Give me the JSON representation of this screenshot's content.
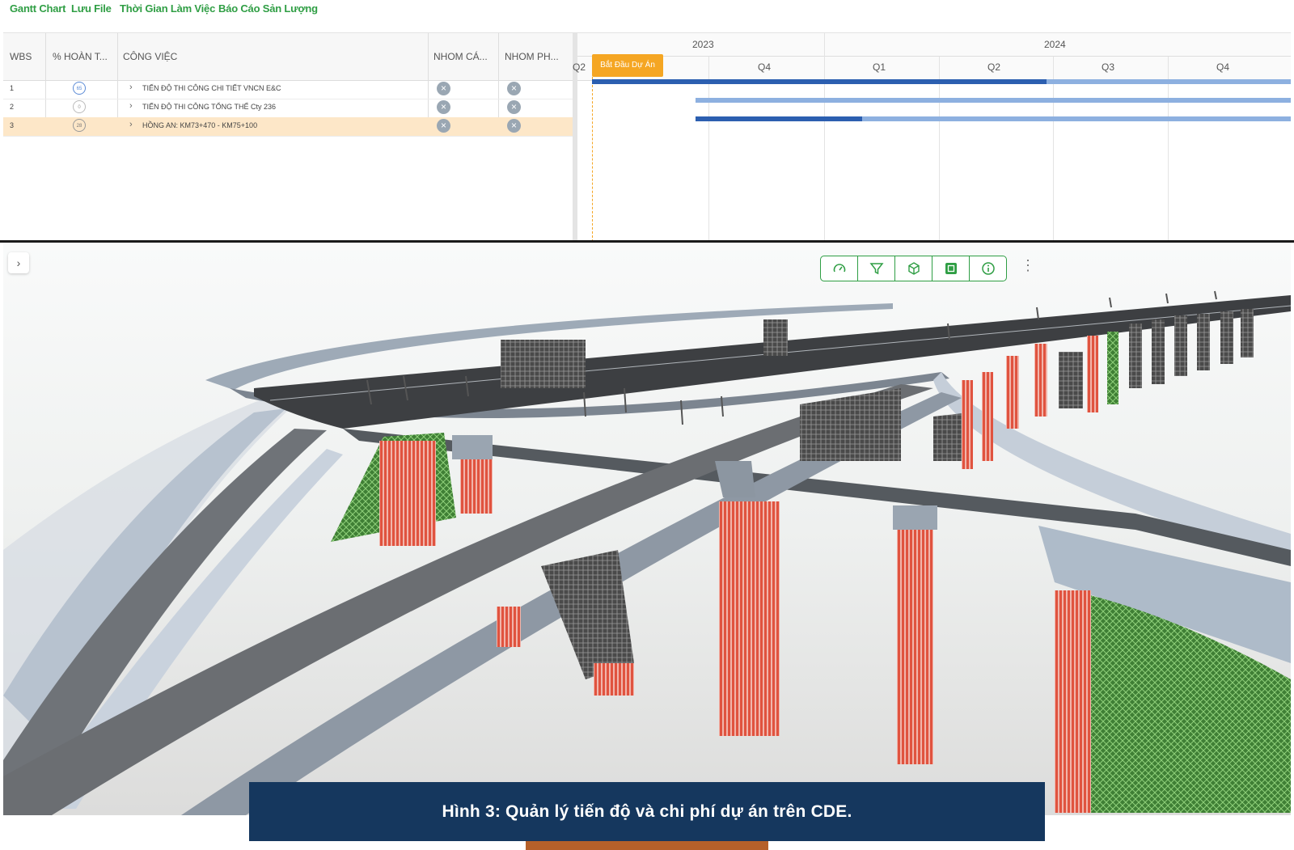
{
  "toolbar": {
    "gantt_chart": "Gantt Chart",
    "save_file": "Lưu File",
    "work_time": "Thời Gian Làm Việc",
    "output_report": "Báo Cáo Sản Lượng"
  },
  "grid": {
    "headers": {
      "wbs": "WBS",
      "percent": "% HOÀN T...",
      "task": "CÔNG VIỆC",
      "group_a": "NHOM CÁ...",
      "group_b": "NHOM PH..."
    },
    "rows": [
      {
        "wbs": "1",
        "percent": "65",
        "task": "TIẾN ĐỘ THI CÔNG CHI TIẾT VNCN E&C",
        "progress": 0.65,
        "selected": false
      },
      {
        "wbs": "2",
        "percent": "0",
        "task": "TIẾN ĐỘ THI CÔNG TỔNG THỂ Cty 236",
        "progress": 0.0,
        "selected": false
      },
      {
        "wbs": "3",
        "percent": "28",
        "task": "HỒNG AN: KM73+470 - KM75+100",
        "progress": 0.28,
        "selected": true
      }
    ]
  },
  "timeline": {
    "years": [
      "2023",
      "2024"
    ],
    "quarters": [
      "Q2",
      "Q3",
      "Q4",
      "Q1",
      "Q2",
      "Q3",
      "Q4"
    ],
    "milestone_label": "Bắt Đầu Dự Án"
  },
  "viewer": {
    "panel_toggle": "›",
    "tools": [
      "speedometer-icon",
      "filter-icon",
      "cube-icon",
      "layers-icon",
      "info-icon"
    ],
    "more": "⋮"
  },
  "caption": "Hình 3: Quản lý tiến độ và chi phí dự án trên CDE.",
  "colors": {
    "accent_green": "#2f9e44",
    "milestone": "#f5a623",
    "bar_light": "#8db0e0",
    "bar_dark": "#2c5fb0",
    "caption_bg": "#15375e",
    "pier_red": "#e86a5a",
    "pile_green": "#4a9a3a"
  }
}
